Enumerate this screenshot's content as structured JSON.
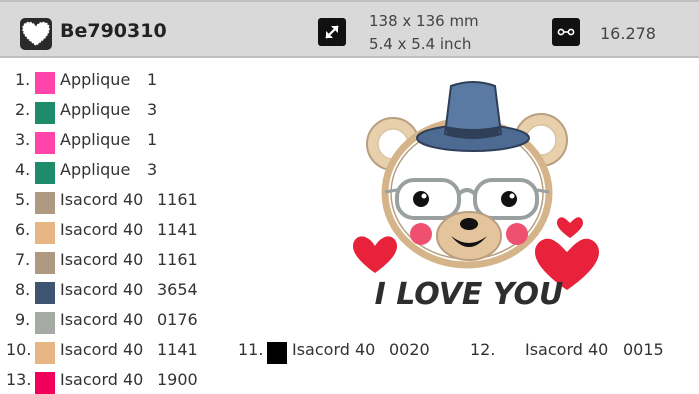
{
  "design": {
    "name": "Be790310",
    "size_mm": "138 x 136 mm",
    "size_inch": "5.4 x 5.4 inch",
    "stitches": "16.278",
    "preview_text": "I LOVE YOU"
  },
  "icons": {
    "logo": "heart-logo-icon",
    "size": "resize-arrows-icon",
    "stitches": "stitch-count-icon"
  },
  "threads": [
    {
      "num": "1.",
      "type": "Applique",
      "code": "1",
      "color": "#ff44aa"
    },
    {
      "num": "2.",
      "type": "Applique",
      "code": "3",
      "color": "#1e8c6a"
    },
    {
      "num": "3.",
      "type": "Applique",
      "code": "1",
      "color": "#ff44aa"
    },
    {
      "num": "4.",
      "type": "Applique",
      "code": "3",
      "color": "#1e8c6a"
    },
    {
      "num": "5.",
      "type": "Isacord 40",
      "code": "1161",
      "color": "#ad9a80"
    },
    {
      "num": "6.",
      "type": "Isacord 40",
      "code": "1141",
      "color": "#e8b585"
    },
    {
      "num": "7.",
      "type": "Isacord 40",
      "code": "1161",
      "color": "#ad9a80"
    },
    {
      "num": "8.",
      "type": "Isacord 40",
      "code": "3654",
      "color": "#3f5470"
    },
    {
      "num": "9.",
      "type": "Isacord 40",
      "code": "0176",
      "color": "#a5aaa5"
    },
    {
      "num": "10.",
      "type": "Isacord 40",
      "code": "1141",
      "color": "#e8b585"
    },
    {
      "num": "11.",
      "type": "Isacord 40",
      "code": "0020",
      "color": "#000000"
    },
    {
      "num": "12.",
      "type": "Isacord 40",
      "code": "0015",
      "color": "#ffffff"
    },
    {
      "num": "13.",
      "type": "Isacord 40",
      "code": "1900",
      "color": "#f0005a"
    }
  ]
}
